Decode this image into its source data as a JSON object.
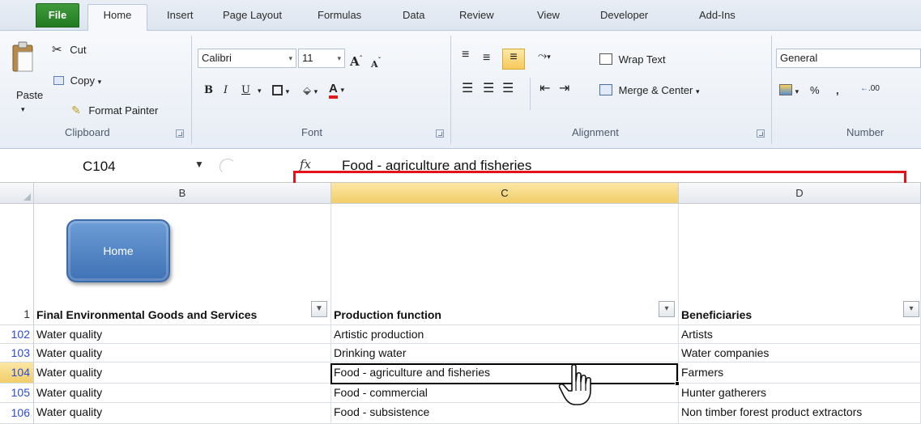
{
  "tabs": [
    {
      "label": "File"
    },
    {
      "label": "Home"
    },
    {
      "label": "Insert"
    },
    {
      "label": "Page Layout"
    },
    {
      "label": "Formulas"
    },
    {
      "label": "Data"
    },
    {
      "label": "Review"
    },
    {
      "label": "View"
    },
    {
      "label": "Developer"
    },
    {
      "label": "Add-Ins"
    }
  ],
  "clipboard": {
    "paste_label": "Paste",
    "cut_label": "Cut",
    "copy_label": "Copy",
    "format_painter_label": "Format Painter",
    "group_label": "Clipboard"
  },
  "font": {
    "font_name": "Calibri",
    "font_size": "11",
    "grow": "A",
    "shrink": "A",
    "bold": "B",
    "italic": "I",
    "underline": "U",
    "font_color": "A",
    "group_label": "Font"
  },
  "alignment": {
    "wrap_text_label": "Wrap Text",
    "merge_center_label": "Merge & Center",
    "group_label": "Alignment"
  },
  "number": {
    "format": "General",
    "percent": "%",
    "comma": ",",
    "decimals": ".00",
    "group_label": "Number"
  },
  "formula_bar": {
    "name_box": "C104",
    "fx": "fx",
    "formula": "Food - agriculture and fisheries"
  },
  "grid": {
    "columns": [
      {
        "label": ""
      },
      {
        "label": "B"
      },
      {
        "label": "C"
      },
      {
        "label": "D"
      }
    ],
    "home_button_label": "Home",
    "header_row_number": "1",
    "headers": {
      "b": "Final Environmental Goods and Services",
      "c": "Production function",
      "d": "Beneficiaries"
    },
    "rows": [
      {
        "num": "102",
        "b": "Water quality",
        "c": "Artistic production",
        "d": "Artists"
      },
      {
        "num": "103",
        "b": "Water quality",
        "c": "Drinking water",
        "d": "Water companies"
      },
      {
        "num": "104",
        "b": "Water quality",
        "c": "Food - agriculture and fisheries",
        "d": "Farmers"
      },
      {
        "num": "105",
        "b": "Water quality",
        "c": "Food - commercial",
        "d": "Hunter gatherers"
      },
      {
        "num": "106",
        "b": "Water quality",
        "c": "Food - subsistence",
        "d": "Non timber forest product extractors"
      }
    ]
  },
  "colors": {
    "file_tab": "#217a1f",
    "highlight": "#e3131a",
    "selected_header": "#f2cd6a",
    "home_button": "#4f82c2"
  }
}
